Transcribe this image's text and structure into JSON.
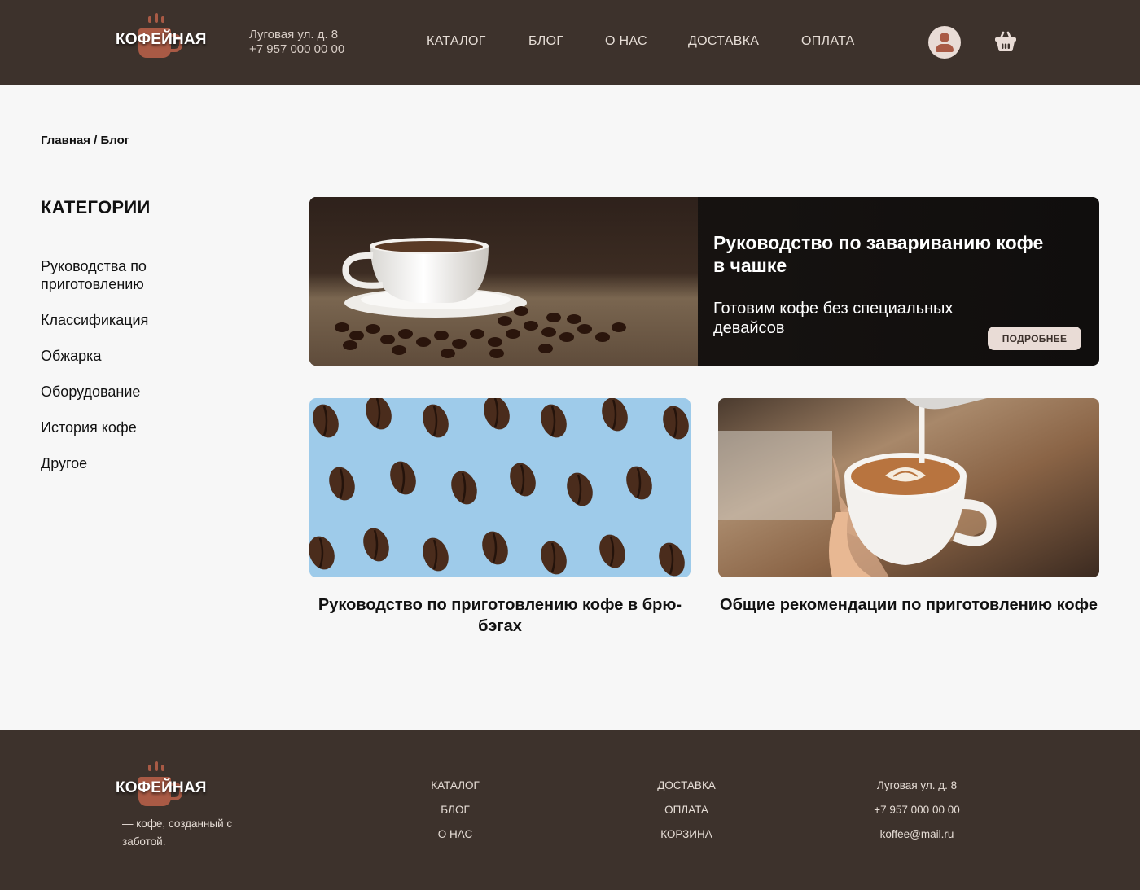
{
  "header": {
    "logo_text": "КОФЕЙНАЯ",
    "address": "Луговая ул. д. 8",
    "phone": "+7 957 000 00 00",
    "nav": [
      "КАТАЛОГ",
      "БЛОГ",
      "О НАС",
      "ДОСТАВКА",
      "ОПЛАТА"
    ],
    "user_icon": "user-icon",
    "cart_icon": "basket-icon"
  },
  "breadcrumb": "Главная / Блог",
  "sidebar": {
    "title": "КАТЕГОРИИ",
    "items": [
      "Руководства по приготовлению",
      "Классификация",
      "Обжарка",
      "Оборудование",
      "История кофе",
      "Другое"
    ]
  },
  "featured": {
    "title": "Руководство по завариванию кофе в чашке",
    "subtitle": "Готовим кофе без специальных девайсов",
    "button": "ПОДРОБНЕЕ"
  },
  "cards": [
    {
      "title": "Руководство по приготовлению кофе в брю-бэгах"
    },
    {
      "title": "Общие рекомендации по приготовлению кофе"
    }
  ],
  "footer": {
    "logo_text": "КОФЕЙНАЯ",
    "tagline": "— кофе, созданный с заботой.",
    "col1": [
      "КАТАЛОГ",
      "БЛОГ",
      "О НАС"
    ],
    "col2": [
      "ДОСТАВКА",
      "ОПЛАТА",
      "КОРЗИНА"
    ],
    "contacts": [
      "Луговая ул. д. 8",
      "+7 957 000 00 00",
      "koffee@mail.ru"
    ]
  },
  "colors": {
    "header_bg": "#3d322c",
    "accent": "#a95a45",
    "page_bg": "#f7f7f7",
    "button_bg": "#e9dcd6"
  }
}
